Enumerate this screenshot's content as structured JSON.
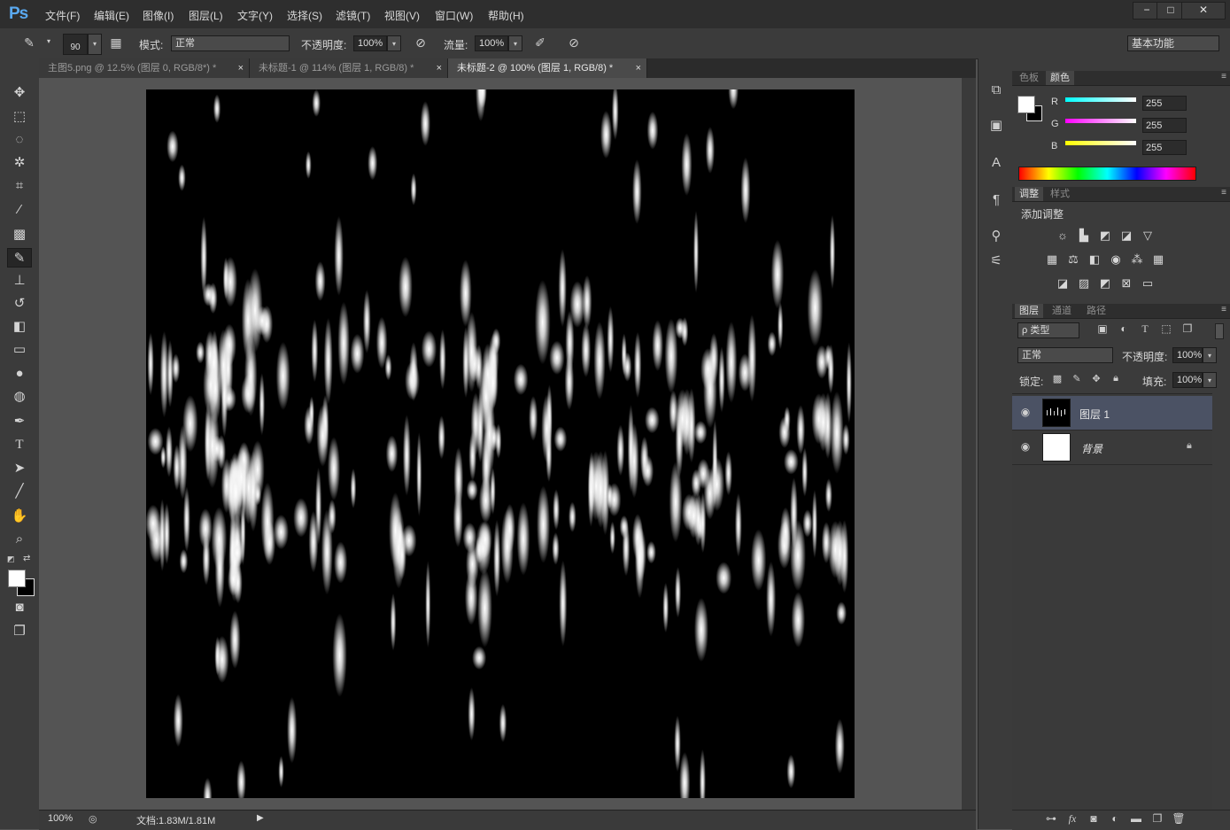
{
  "app": {
    "logo": "Ps"
  },
  "menu": [
    "文件(F)",
    "编辑(E)",
    "图像(I)",
    "图层(L)",
    "文字(Y)",
    "选择(S)",
    "滤镜(T)",
    "视图(V)",
    "窗口(W)",
    "帮助(H)"
  ],
  "window_controls": {
    "minimize": "−",
    "maximize": "□",
    "close": "✕"
  },
  "options": {
    "brush_size": "90",
    "mode_label": "模式:",
    "mode_value": "正常",
    "opacity_label": "不透明度:",
    "opacity_value": "100%",
    "flow_label": "流量:",
    "flow_value": "100%",
    "workspace_value": "基本功能"
  },
  "tabs": [
    {
      "label": "主图5.png @ 12.5% (图层 0, RGB/8*) *",
      "close": "×"
    },
    {
      "label": "未标题-1 @ 114% (图层 1, RGB/8) *",
      "close": "×"
    },
    {
      "label": "未标题-2 @ 100% (图层 1, RGB/8) *",
      "close": "×"
    }
  ],
  "active_tab": 2,
  "status": {
    "zoom": "100%",
    "doc_info": "文档:1.83M/1.81M"
  },
  "color_panel": {
    "tabs": [
      "色板",
      "颜色"
    ],
    "r_label": "R",
    "r_value": "255",
    "g_label": "G",
    "g_value": "255",
    "b_label": "B",
    "b_value": "255"
  },
  "adjust_panel": {
    "tabs": [
      "调整",
      "样式"
    ],
    "title": "添加调整"
  },
  "layers_panel": {
    "tabs": [
      "图层",
      "通道",
      "路径"
    ],
    "filter_value": "ρ 类型",
    "blend_value": "正常",
    "opacity_label": "不透明度:",
    "opacity_value": "100%",
    "lock_label": "锁定:",
    "fill_label": "填充:",
    "fill_value": "100%",
    "layers": [
      {
        "name": "图层 1",
        "selected": true
      },
      {
        "name": "背景",
        "selected": false,
        "locked": true
      }
    ],
    "footer_fx": "fx"
  },
  "colors": {
    "accent_layer_selected": "#4b5264",
    "canvas_background": "#000000",
    "foreground_color": "#ffffff"
  }
}
